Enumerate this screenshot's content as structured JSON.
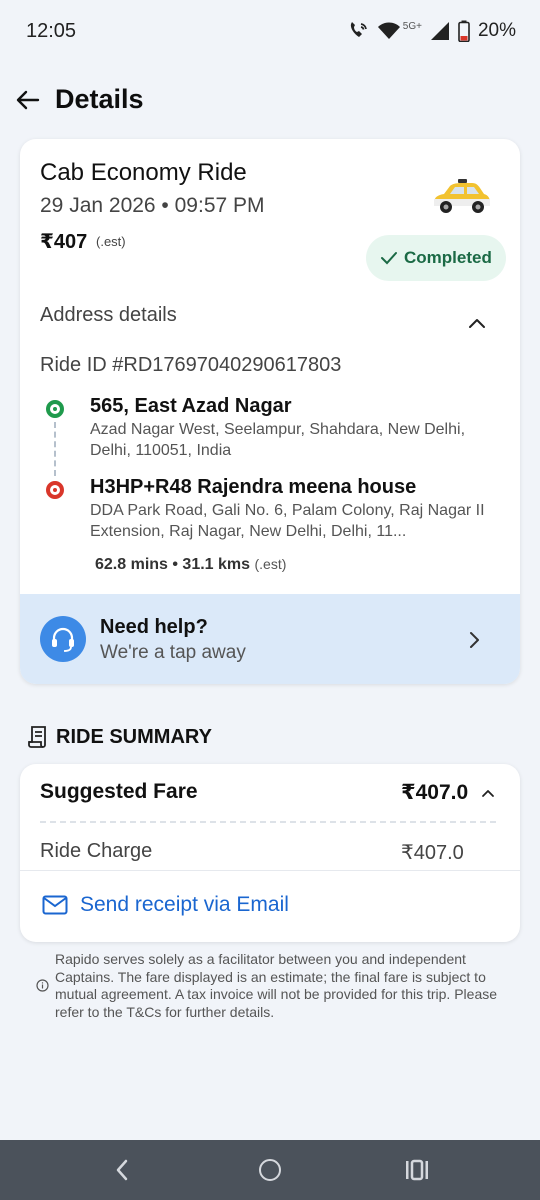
{
  "status_bar": {
    "time": "12:05",
    "network": "5G+",
    "battery": "20%"
  },
  "header": {
    "title": "Details",
    "back_icon": "arrow-left-icon"
  },
  "ride": {
    "title": "Cab Economy Ride",
    "datetime": "29 Jan 2026 • 09:57 PM",
    "fare": "₹407",
    "fare_note": "(.est)",
    "status": "Completed",
    "address_header": "Address details",
    "ride_id": "Ride ID #RD17697040290617803",
    "pickup": {
      "title": "565, East Azad Nagar",
      "address": "Azad Nagar West, Seelampur, Shahdara, New Delhi, Delhi, 110051, India"
    },
    "drop": {
      "title": "H3HP+R48 Rajendra meena house",
      "address": "DDA Park Road, Gali No. 6, Palam Colony, Raj Nagar II Extension, Raj Nagar, New Delhi, Delhi, 11..."
    },
    "stats": "62.8 mins • 31.1 kms",
    "stats_note": "(.est)"
  },
  "help": {
    "title": "Need help?",
    "subtitle": "We're a tap away"
  },
  "summary": {
    "heading": "RIDE SUMMARY",
    "fare_title": "Suggested Fare",
    "fare_total": "₹407.0",
    "charge_label": "Ride Charge",
    "charge_value": "₹407.0",
    "email_label": "Send receipt via Email"
  },
  "disclaimer": "Rapido serves solely as a facilitator between you and independent Captains. The fare displayed is an estimate; the final fare is subject to mutual agreement. A tax invoice will not be provided for this trip. Please refer to the T&Cs for further details.",
  "colors": {
    "accent_blue": "#1a66d0",
    "completed_green": "#1b6a45",
    "pickup_green": "#1f9a4c",
    "drop_red": "#d9362a",
    "help_bg": "#dbe9f9"
  }
}
